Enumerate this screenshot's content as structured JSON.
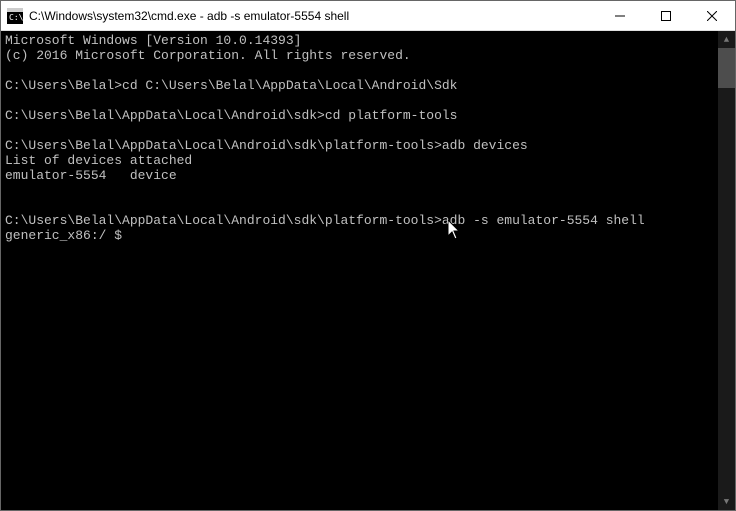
{
  "titlebar": {
    "title": "C:\\Windows\\system32\\cmd.exe - adb  -s emulator-5554 shell"
  },
  "terminal": {
    "line1": "Microsoft Windows [Version 10.0.14393]",
    "line2": "(c) 2016 Microsoft Corporation. All rights reserved.",
    "blank1": "",
    "line3": "C:\\Users\\Belal>cd C:\\Users\\Belal\\AppData\\Local\\Android\\Sdk",
    "blank2": "",
    "line4": "C:\\Users\\Belal\\AppData\\Local\\Android\\sdk>cd platform-tools",
    "blank3": "",
    "line5": "C:\\Users\\Belal\\AppData\\Local\\Android\\sdk\\platform-tools>adb devices",
    "line6": "List of devices attached",
    "line7": "emulator-5554   device",
    "blank4": "",
    "blank5": "",
    "line8": "C:\\Users\\Belal\\AppData\\Local\\Android\\sdk\\platform-tools>adb -s emulator-5554 shell",
    "line9": "generic_x86:/ $"
  }
}
